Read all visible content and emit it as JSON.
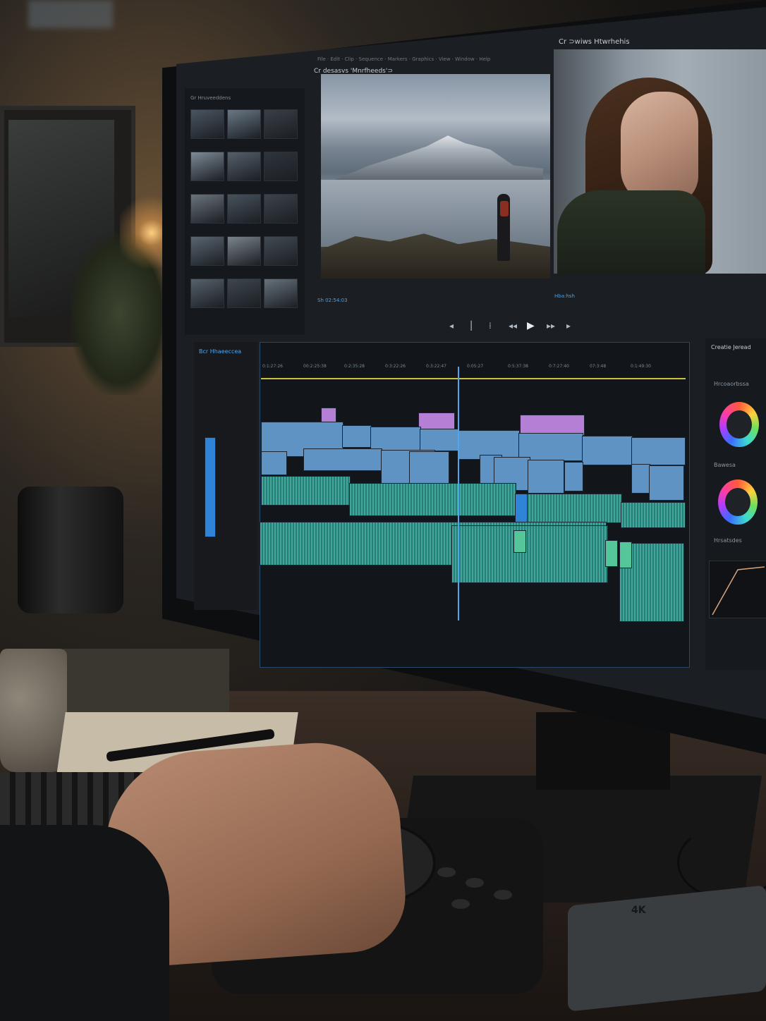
{
  "scene": {
    "description_subject": "video editing workstation"
  },
  "editor": {
    "top_title": "Cr ⊃wiws Htwrhehis",
    "tab_title": "Cr desasvs 'Mnrfheeds'⊃",
    "bin_title": "Gr Hruveeddens",
    "timeline_title": "Bcr Hhaeeccea",
    "timecode_left": "Sh 02:54:03",
    "timecode_right": "Hba:hsh",
    "panel_title": "Creatie Jeread",
    "panel_label_1": "Hrcoaorbssa",
    "panel_label_2": "Bawesa",
    "panel_label_3": "Hrsatsdes",
    "ruler_ticks": [
      "0:1:27:26",
      "00:2:25:38",
      "0:2:35:28",
      "0:3:22:26",
      "0:3:22:47",
      "0:05:27",
      "0:5:37:38",
      "0:7:27:40",
      "07:3:48",
      "0:1:49:30"
    ]
  },
  "brand": {
    "dongle_label": "4K"
  },
  "colors": {
    "video_clip": "#5f93c4",
    "audio_clip": "#3fa79c",
    "title_clip": "#b57fd6",
    "playhead": "#4fa6ef",
    "ruler_marker": "#c9c23a"
  },
  "icons": [
    "play-icon",
    "next-frame-icon",
    "prev-frame-icon",
    "mark-in-icon",
    "mark-out-icon"
  ]
}
